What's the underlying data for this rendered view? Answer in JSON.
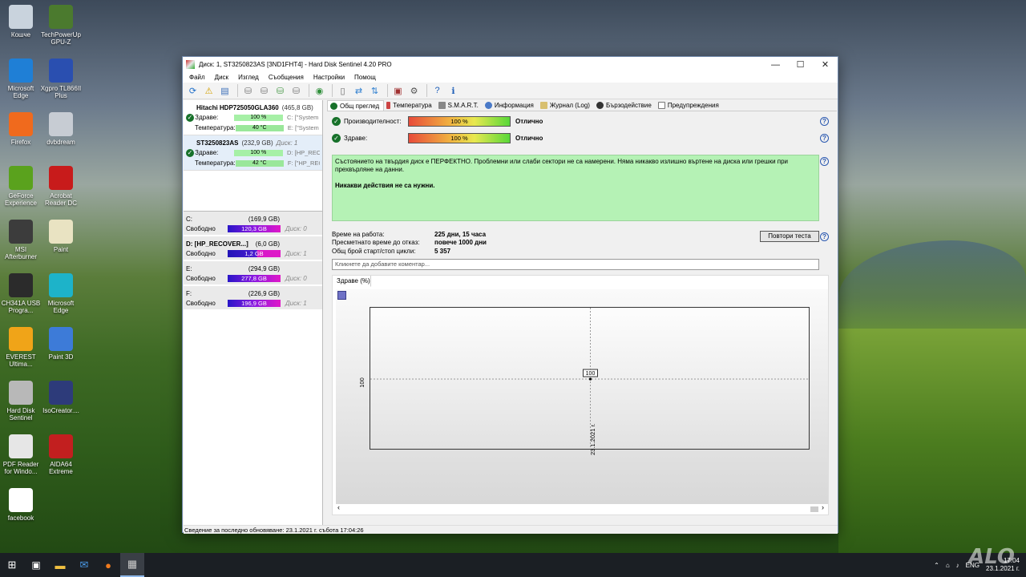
{
  "desktop_icons": [
    {
      "label": "Кошче",
      "color": "#c9d3dd"
    },
    {
      "label": "TechPowerUp GPU-Z",
      "color": "#4b7a2e"
    },
    {
      "label": "Microsoft Edge",
      "color": "#1f7fd6"
    },
    {
      "label": "Xgpro TL866II Plus",
      "color": "#2a4fb0"
    },
    {
      "label": "Firefox",
      "color": "#f06a1d"
    },
    {
      "label": "dvbdream",
      "color": "#c7ccd3"
    },
    {
      "label": "GeForce Experience",
      "color": "#5aa21d"
    },
    {
      "label": "Acrobat Reader DC",
      "color": "#c81b1b"
    },
    {
      "label": "MSI Afterburner",
      "color": "#3c3c3c"
    },
    {
      "label": "Paint",
      "color": "#e9e3c2"
    },
    {
      "label": "CH341A USB Progra...",
      "color": "#2b2b2b"
    },
    {
      "label": "Microsoft Edge",
      "color": "#1db3c9"
    },
    {
      "label": "EVEREST Ultima...",
      "color": "#f0a418"
    },
    {
      "label": "Paint 3D",
      "color": "#3d7bd8"
    },
    {
      "label": "Hard Disk Sentinel",
      "color": "#b8b8b8"
    },
    {
      "label": "IsoCreator....",
      "color": "#2d3b7a"
    },
    {
      "label": "PDF Reader for Windo...",
      "color": "#e6e6e6"
    },
    {
      "label": "AIDA64 Extreme",
      "color": "#c21f1f"
    },
    {
      "label": "facebook",
      "color": "#ffffff"
    }
  ],
  "window": {
    "title": "Диск: 1, ST3250823AS [3ND1FHT4]  -  Hard Disk Sentinel 4.20 PRO",
    "minimize": "—",
    "maximize": "☐",
    "close": "✕"
  },
  "menu": [
    "Файл",
    "Диск",
    "Изглед",
    "Съобщения",
    "Настройки",
    "Помощ"
  ],
  "disks": [
    {
      "name": "Hitachi HDP725050GLA360",
      "size": "(465,8 GB)",
      "disk_label": "",
      "health_label": "Здраве:",
      "health": "100 %",
      "health_vol": "C: [\"System Re",
      "temp_label": "Температура:",
      "temp": "40 °C",
      "temp_vol": "E: [\"System Re"
    },
    {
      "name": "ST3250823AS",
      "size": "(232,9 GB)",
      "disk_label": "Диск: 1",
      "health_label": "Здраве:",
      "health": "100 %",
      "health_vol": "D: [HP_RECOV",
      "temp_label": "Температура:",
      "temp": "42 °C",
      "temp_vol": "F: [\"HP_RECO"
    }
  ],
  "partitions": [
    {
      "letter": "C:",
      "size": "(169,9 GB)",
      "free_label": "Свободно",
      "free": "120,3 GB",
      "free_pct": 0.71,
      "disk": "Диск: 0"
    },
    {
      "letter": "D: [HP_RECOVER...]",
      "size": "(6,0 GB)",
      "free_label": "Свободно",
      "free": "1,2 GB",
      "free_pct": 0.2,
      "disk": "Диск: 1"
    },
    {
      "letter": "E:",
      "size": "(294,9 GB)",
      "free_label": "Свободно",
      "free": "277,8 GB",
      "free_pct": 0.94,
      "disk": "Диск: 0"
    },
    {
      "letter": "F:",
      "size": "(226,9 GB)",
      "free_label": "Свободно",
      "free": "196,9 GB",
      "free_pct": 0.87,
      "disk": "Диск: 1"
    }
  ],
  "tabs": [
    "Общ преглед",
    "Температура",
    "S.M.A.R.T.",
    "Информация",
    "Журнал (Log)",
    "Бързодействие",
    "Предупреждения"
  ],
  "overview": {
    "performance_label": "Производителност:",
    "performance": "100 %",
    "performance_text": "Отлично",
    "health_label": "Здраве:",
    "health": "100 %",
    "health_text": "Отлично",
    "description": "Състоянието на твърдия диск е ПЕРФЕКТНО. Проблемни или слаби сектори не са намерени. Няма никакво излишно въртене на диска или грешки при прехвърляне на данни.",
    "action": "Никакви действия не са нужни.",
    "uptime_label": "Време на работа:",
    "uptime": "225 дни, 15 часа",
    "remaining_label": "Пресметнато време до отказ:",
    "remaining": "повече 1000 дни",
    "cycles_label": "Общ брой старт/стоп цикли:",
    "cycles": "5 357",
    "retest_button": "Повтори теста",
    "comment_placeholder": "Кликнете да добавите коментар...",
    "chart_tab": "Здраве (%)"
  },
  "chart_data": {
    "type": "line",
    "x": [
      "23.1.2021 г."
    ],
    "series": [
      {
        "values": [
          100
        ]
      }
    ],
    "ytick": "100",
    "point_label": "100"
  },
  "statusbar": "Сведение за последно обновяване: 23.1.2021 г. събота 17:04:26",
  "tray": {
    "lang": "ENG",
    "time": "17:04",
    "date": "23.1.2021 г."
  },
  "watermark": "ALO"
}
